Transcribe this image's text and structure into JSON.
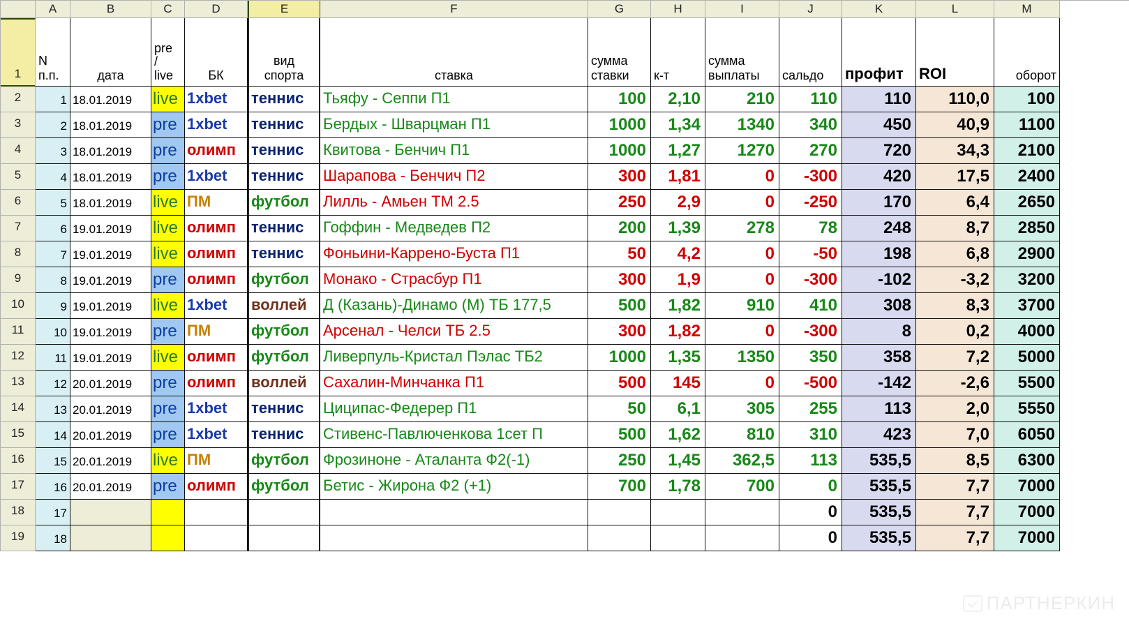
{
  "colLetters": [
    "A",
    "B",
    "C",
    "D",
    "E",
    "F",
    "G",
    "H",
    "I",
    "J",
    "K",
    "L",
    "M"
  ],
  "header": {
    "A": "N п.п.",
    "B": "дата",
    "C": "pre / live",
    "D": "БК",
    "E": "вид спорта",
    "F": "ставка",
    "G": "сумма ставки",
    "H": "к-т",
    "I": "сумма выплаты",
    "J": "сальдо",
    "K": "профит",
    "L": "ROI",
    "M": "оборот"
  },
  "selectedCol": "E",
  "selectedRow": 1,
  "rows": [
    {
      "r": 2,
      "n": 1,
      "date": "18.01.2019",
      "mode": "live",
      "bk": "1xbet",
      "sport": "теннис",
      "bet": "Тьяфу - Сеппи П1",
      "sum": 100,
      "k": "2,10",
      "pay": 210,
      "saldo": 110,
      "profit": "110",
      "roi": "110,0",
      "turn": 100,
      "res": "win"
    },
    {
      "r": 3,
      "n": 2,
      "date": "18.01.2019",
      "mode": "pre",
      "bk": "1xbet",
      "sport": "теннис",
      "bet": "Бердых - Шварцман П1",
      "sum": 1000,
      "k": "1,34",
      "pay": 1340,
      "saldo": 340,
      "profit": "450",
      "roi": "40,9",
      "turn": 1100,
      "res": "win"
    },
    {
      "r": 4,
      "n": 3,
      "date": "18.01.2019",
      "mode": "pre",
      "bk": "олимп",
      "sport": "теннис",
      "bet": "Квитова - Бенчич П1",
      "sum": 1000,
      "k": "1,27",
      "pay": 1270,
      "saldo": 270,
      "profit": "720",
      "roi": "34,3",
      "turn": 2100,
      "res": "win"
    },
    {
      "r": 5,
      "n": 4,
      "date": "18.01.2019",
      "mode": "pre",
      "bk": "1xbet",
      "sport": "теннис",
      "bet": "Шарапова - Бенчич П2",
      "sum": 300,
      "k": "1,81",
      "pay": 0,
      "saldo": -300,
      "profit": "420",
      "roi": "17,5",
      "turn": 2400,
      "res": "loss"
    },
    {
      "r": 6,
      "n": 5,
      "date": "18.01.2019",
      "mode": "live",
      "bk": "ПМ",
      "sport": "футбол",
      "bet": "Лилль - Амьен ТМ 2.5",
      "sum": 250,
      "k": "2,9",
      "pay": 0,
      "saldo": -250,
      "profit": "170",
      "roi": "6,4",
      "turn": 2650,
      "res": "loss"
    },
    {
      "r": 7,
      "n": 6,
      "date": "19.01.2019",
      "mode": "live",
      "bk": "олимп",
      "sport": "теннис",
      "bet": "Гоффин - Медведев П2",
      "sum": 200,
      "k": "1,39",
      "pay": 278,
      "saldo": 78,
      "profit": "248",
      "roi": "8,7",
      "turn": 2850,
      "res": "win"
    },
    {
      "r": 8,
      "n": 7,
      "date": "19.01.2019",
      "mode": "live",
      "bk": "олимп",
      "sport": "теннис",
      "bet": "Фоньини-Каррено-Буста П1",
      "sum": 50,
      "k": "4,2",
      "pay": 0,
      "saldo": -50,
      "profit": "198",
      "roi": "6,8",
      "turn": 2900,
      "res": "loss"
    },
    {
      "r": 9,
      "n": 8,
      "date": "19.01.2019",
      "mode": "pre",
      "bk": "олимп",
      "sport": "футбол",
      "bet": "Монако - Страсбур П1",
      "sum": 300,
      "k": "1,9",
      "pay": 0,
      "saldo": -300,
      "profit": "-102",
      "roi": "-3,2",
      "turn": 3200,
      "res": "loss"
    },
    {
      "r": 10,
      "n": 9,
      "date": "19.01.2019",
      "mode": "live",
      "bk": "1xbet",
      "sport": "воллей",
      "bet": "Д (Казань)-Динамо (М) ТБ 177,5",
      "sum": 500,
      "k": "1,82",
      "pay": 910,
      "saldo": 410,
      "profit": "308",
      "roi": "8,3",
      "turn": 3700,
      "res": "win"
    },
    {
      "r": 11,
      "n": 10,
      "date": "19.01.2019",
      "mode": "pre",
      "bk": "ПМ",
      "sport": "футбол",
      "bet": "Арсенал - Челси ТБ 2.5",
      "sum": 300,
      "k": "1,82",
      "pay": 0,
      "saldo": -300,
      "profit": "8",
      "roi": "0,2",
      "turn": 4000,
      "res": "loss"
    },
    {
      "r": 12,
      "n": 11,
      "date": "19.01.2019",
      "mode": "live",
      "bk": "олимп",
      "sport": "футбол",
      "bet": "Ливерпуль-Кристал Пэлас ТБ2",
      "sum": 1000,
      "k": "1,35",
      "pay": 1350,
      "saldo": 350,
      "profit": "358",
      "roi": "7,2",
      "turn": 5000,
      "res": "win"
    },
    {
      "r": 13,
      "n": 12,
      "date": "20.01.2019",
      "mode": "pre",
      "bk": "олимп",
      "sport": "воллей",
      "bet": "Сахалин-Минчанка П1",
      "sum": 500,
      "k": "145",
      "pay": 0,
      "saldo": -500,
      "profit": "-142",
      "roi": "-2,6",
      "turn": 5500,
      "res": "loss"
    },
    {
      "r": 14,
      "n": 13,
      "date": "20.01.2019",
      "mode": "pre",
      "bk": "1xbet",
      "sport": "теннис",
      "bet": "Циципас-Федерер П1",
      "sum": 50,
      "k": "6,1",
      "pay": 305,
      "saldo": 255,
      "profit": "113",
      "roi": "2,0",
      "turn": 5550,
      "res": "win"
    },
    {
      "r": 15,
      "n": 14,
      "date": "20.01.2019",
      "mode": "pre",
      "bk": "1xbet",
      "sport": "теннис",
      "bet": "Стивенс-Павлюченкова 1сет П",
      "sum": 500,
      "k": "1,62",
      "pay": 810,
      "saldo": 310,
      "profit": "423",
      "roi": "7,0",
      "turn": 6050,
      "res": "win"
    },
    {
      "r": 16,
      "n": 15,
      "date": "20.01.2019",
      "mode": "live",
      "bk": "ПМ",
      "sport": "футбол",
      "bet": "Фрозиноне - Аталанта Ф2(-1)",
      "sum": 250,
      "k": "1,45",
      "pay": "362,5",
      "saldo": 113,
      "profit": "535,5",
      "roi": "8,5",
      "turn": 6300,
      "res": "win"
    },
    {
      "r": 17,
      "n": 16,
      "date": "20.01.2019",
      "mode": "pre",
      "bk": "олимп",
      "sport": "футбол",
      "bet": "Бетис - Жирона Ф2 (+1)",
      "sum": 700,
      "k": "1,78",
      "pay": 700,
      "saldo": 0,
      "profit": "535,5",
      "roi": "7,7",
      "turn": 7000,
      "res": "win"
    }
  ],
  "tailRows": [
    {
      "r": 18,
      "n": 17,
      "saldo": "0",
      "profit": "535,5",
      "roi": "7,7",
      "turn": 7000
    },
    {
      "r": 19,
      "n": 18,
      "saldo": "0",
      "profit": "535,5",
      "roi": "7,7",
      "turn": 7000
    }
  ],
  "watermark": "ПАРТНЕРКИН"
}
